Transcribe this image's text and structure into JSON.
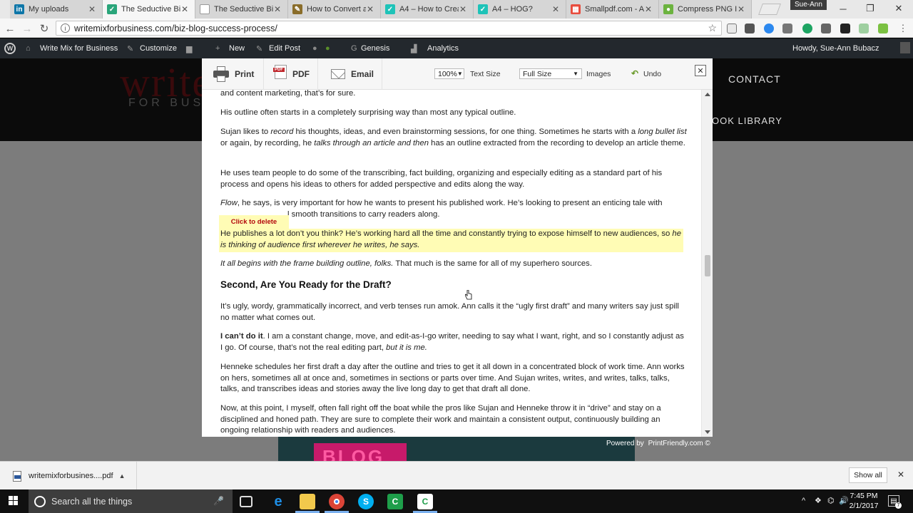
{
  "browser": {
    "tabs": [
      {
        "title": "My uploads",
        "icon": "linkedin-icon",
        "color": "#0e76a8"
      },
      {
        "title": "The Seductive Biz",
        "icon": "site-icon",
        "color": "#2aa57a"
      },
      {
        "title": "The Seductive Biz",
        "icon": "page-icon",
        "color": "#999999"
      },
      {
        "title": "How to Convert a",
        "icon": "pencil-icon",
        "color": "#8a6d2a"
      },
      {
        "title": "A4 – How to Crea",
        "icon": "site-icon",
        "color": "#1ec3b8"
      },
      {
        "title": "A4 – HOG?",
        "icon": "site-icon",
        "color": "#1ec3b8"
      },
      {
        "title": "Smallpdf.com - A",
        "icon": "smallpdf-icon",
        "color": "#e84c3d"
      },
      {
        "title": "Compress PNG Im",
        "icon": "panda-icon",
        "color": "#6cb33f"
      }
    ],
    "profile_name": "Sue-Ann",
    "url": "writemixforbusiness.com/biz-blog-success-process/"
  },
  "wp_admin_bar": {
    "site_name": "Write Mix for Business",
    "customize": "Customize",
    "new": "New",
    "edit_post": "Edit Post",
    "genesis": "Genesis",
    "analytics": "Analytics",
    "greeting": "Howdy, Sue-Ann Bubacz"
  },
  "site": {
    "logo_word": "write",
    "logo_sub": "FOR BUS",
    "nav_contact": "CONTACT",
    "nav_library": "OOK LIBRARY",
    "banner_text": "BLOG"
  },
  "printfriendly": {
    "print_label": "Print",
    "pdf_label": "PDF",
    "pdf_icon_text": "PDF",
    "email_label": "Email",
    "text_size_value": "100%",
    "text_size_label": "Text Size",
    "images_value": "Full Size",
    "images_label": "Images",
    "undo_label": "Undo",
    "click_to_delete": "Click to delete",
    "heading": "Second, Are You Ready for the Draft?",
    "powered_by": "Powered by",
    "powered_brand": "PrintFriendly.com ©",
    "paragraphs": {
      "p1": "and content marketing, that’s for sure.",
      "p2": "His outline often starts in a completely surprising way than most any typical outline.",
      "p3a": "Sujan likes to ",
      "p3b": "record",
      "p3c": " his thoughts, ideas, and even brainstorming sessions, for one thing. Sometimes he starts with a ",
      "p3d": "long bullet list",
      "p3e": " or again, by recording, he ",
      "p3f": "talks through an article and then",
      "p3g": " has an outline extracted from the recording to develop an article theme.",
      "p4": "He uses team people to do some of the transcribing, fact building, organizing and especially editing as a standard part of his process and opens his ideas to others for added perspective and edits along the way.",
      "p5a": "Flow",
      "p5b": ", he says, is very important for how he wants to present his published work. He’s looking to present an enticing tale with",
      "p5c": "l smooth transitions to carry readers along.",
      "p6a": "He publishes a lot don’t you think? He’s working hard all the time and constantly trying to expose himself to new audiences, so ",
      "p6b": "he is thinking of audience first wherever he writes, he says.",
      "p7a": "It all begins with the frame building outline, folks.",
      "p7b": " That much is the same for all of my superhero sources.",
      "p8": "It’s ugly, wordy, grammatically incorrect, and verb tenses run amok. Ann calls it the “ugly first draft” and many writers say just spill no matter what comes out.",
      "p9a": "I can’t do it",
      "p9b": ". I am a constant change, move, and edit-as-I-go writer, needing to say what I want, right, and so I constantly adjust as I go. Of course, that’s not the real editing part, ",
      "p9c": "but it is me.",
      "p10": "Henneke schedules her first draft a day after the outline and tries to get it all down in a concentrated block of work time. Ann works on hers, sometimes all at once and, sometimes in sections or parts over time. And Sujan writes, writes, and writes, talks, talks, talks, and transcribes ideas and stories away the live long day to get that draft all done.",
      "p11": "Now, at this point, I myself, often fall right off the boat while the pros like Sujan and Henneke throw it in “drive” and stay on a disciplined and honed path. They are sure to complete their work and maintain a consistent output, continuously building an ongoing relationship with readers and audiences."
    }
  },
  "download_bar": {
    "filename": "writemixforbusines....pdf",
    "show_all": "Show all"
  },
  "taskbar": {
    "search_placeholder": "Search all the things",
    "time": "7:45 PM",
    "date": "2/1/2017",
    "notification_count": "7"
  }
}
